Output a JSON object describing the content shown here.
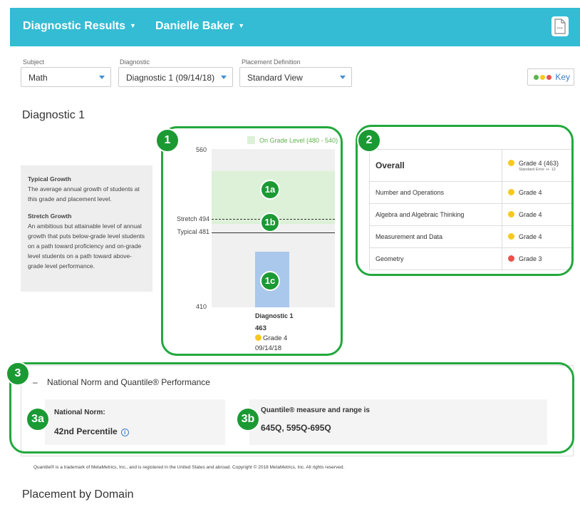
{
  "header": {
    "title": "Diagnostic Results",
    "student": "Danielle Baker",
    "pdf_label": "PDF"
  },
  "filters": {
    "subject": {
      "label": "Subject",
      "value": "Math"
    },
    "diagnostic": {
      "label": "Diagnostic",
      "value": "Diagnostic 1 (09/14/18)"
    },
    "placement": {
      "label": "Placement Definition",
      "value": "Standard View"
    },
    "key_label": "Key"
  },
  "diagnostic_title": "Diagnostic 1",
  "explain": {
    "typical_title": "Typical Growth",
    "typical_text": "The average annual growth of students at this grade and placement level.",
    "stretch_title": "Stretch Growth",
    "stretch_text": "An ambitious but attainable level of annual growth that puts below-grade level students on a path toward proficiency and on-grade level students on a path toward above-grade level performance."
  },
  "chart": {
    "legend": "On Grade Level (480 - 540)",
    "y_max_label": "560",
    "y_min_label": "410",
    "stretch_label": "Stretch 494",
    "typical_label": "Typical 481",
    "bar_title": "Diagnostic 1",
    "bar_score": "463",
    "bar_grade": "Grade 4",
    "bar_date": "09/14/18"
  },
  "chart_data": {
    "type": "bar",
    "categories": [
      "Diagnostic 1"
    ],
    "values": [
      463
    ],
    "ylim": [
      410,
      560
    ],
    "on_grade_band": [
      480,
      540
    ],
    "stretch": 494,
    "typical": 481,
    "legend": "On Grade Level (480 - 540)"
  },
  "callouts": {
    "c1": "1",
    "c1a": "1a",
    "c1b": "1b",
    "c1c": "1c",
    "c2": "2",
    "c3": "3",
    "c3a": "3a",
    "c3b": "3b"
  },
  "domains": {
    "overall": {
      "name": "Overall",
      "grade": "Grade 4 (463)",
      "se": "Standard Error +/- 12",
      "color": "#f7c91e"
    },
    "rows": [
      {
        "name": "Number and Operations",
        "grade": "Grade 4",
        "color": "#f7c91e"
      },
      {
        "name": "Algebra and Algebraic Thinking",
        "grade": "Grade 4",
        "color": "#f7c91e"
      },
      {
        "name": "Measurement and Data",
        "grade": "Grade 4",
        "color": "#f7c91e"
      },
      {
        "name": "Geometry",
        "grade": "Grade 3",
        "color": "#e8534d"
      }
    ]
  },
  "norm": {
    "collapse": "–",
    "title": "National Norm and Quantile® Performance",
    "norm_label": "National Norm:",
    "norm_value": "42nd Percentile",
    "info": "i",
    "quantile_label": "Quantile® measure and range is",
    "quantile_value": "645Q, 595Q-695Q"
  },
  "footnote": "Quantile® is a trademark of MetaMetrics, Inc., and is registered in the United States and abroad. Copyright © 2018 MetaMetrics, Inc. All rights reserved.",
  "placement_title": "Placement by Domain"
}
